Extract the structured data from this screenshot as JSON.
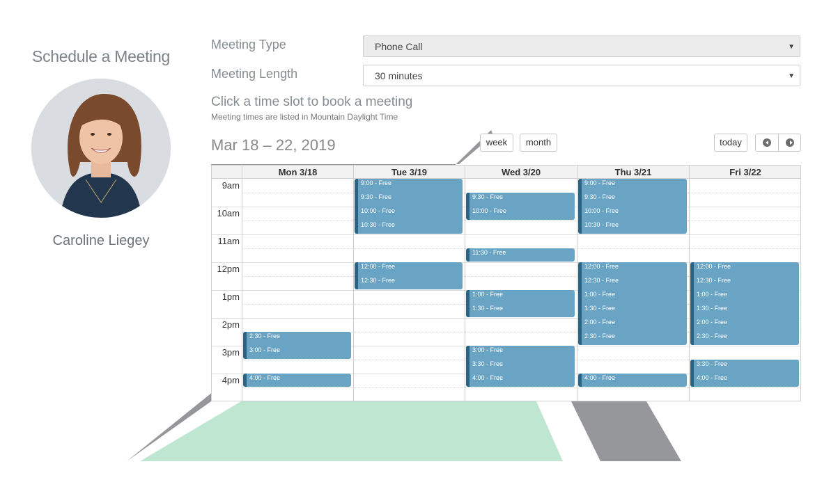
{
  "left_panel": {
    "title": "Schedule a Meeting",
    "host_name": "Caroline Liegey"
  },
  "form": {
    "meeting_type_label": "Meeting Type",
    "meeting_type_value": "Phone Call",
    "meeting_length_label": "Meeting Length",
    "meeting_length_value": "30 minutes",
    "hint_title": "Click a time slot to book a meeting",
    "hint_sub": "Meeting times are listed in Mountain Daylight Time"
  },
  "toolbar": {
    "date_range": "Mar 18 – 22, 2019",
    "week_label": "week",
    "month_label": "month",
    "today_label": "today"
  },
  "calendar": {
    "days": [
      "Mon 3/18",
      "Tue 3/19",
      "Wed 3/20",
      "Thu 3/21",
      "Fri 3/22"
    ],
    "hours": [
      "9am",
      "10am",
      "11am",
      "12pm",
      "1pm",
      "2pm",
      "3pm",
      "4pm"
    ],
    "free_blocks": [
      {
        "day": 0,
        "slots": [
          "2:30 - Free",
          "3:00 - Free"
        ]
      },
      {
        "day": 0,
        "slots": [
          "4:00 - Free"
        ]
      },
      {
        "day": 1,
        "slots": [
          "9:00 - Free",
          "9:30 - Free",
          "10:00 - Free",
          "10:30 - Free"
        ]
      },
      {
        "day": 1,
        "slots": [
          "12:00 - Free",
          "12:30 - Free"
        ]
      },
      {
        "day": 2,
        "slots": [
          "9:30 - Free",
          "10:00 - Free"
        ]
      },
      {
        "day": 2,
        "slots": [
          "11:30 - Free"
        ]
      },
      {
        "day": 2,
        "slots": [
          "1:00 - Free",
          "1:30 - Free"
        ]
      },
      {
        "day": 2,
        "slots": [
          "3:00 - Free",
          "3:30 - Free",
          "4:00 - Free"
        ]
      },
      {
        "day": 3,
        "slots": [
          "9:00 - Free",
          "9:30 - Free",
          "10:00 - Free",
          "10:30 - Free"
        ]
      },
      {
        "day": 3,
        "slots": [
          "12:00 - Free",
          "12:30 - Free",
          "1:00 - Free",
          "1:30 - Free",
          "2:00 - Free",
          "2:30 - Free"
        ]
      },
      {
        "day": 3,
        "slots": [
          "4:00 - Free"
        ]
      },
      {
        "day": 4,
        "slots": [
          "12:00 - Free",
          "12:30 - Free",
          "1:00 - Free",
          "1:30 - Free",
          "2:00 - Free",
          "2:30 - Free"
        ]
      },
      {
        "day": 4,
        "slots": [
          "3:30 - Free",
          "4:00 - Free"
        ]
      }
    ]
  },
  "colors": {
    "event_fill": "#6aa4c4",
    "event_border": "#2a6484",
    "accent_green": "#bfe6d1",
    "accent_gray": "#96979b"
  }
}
